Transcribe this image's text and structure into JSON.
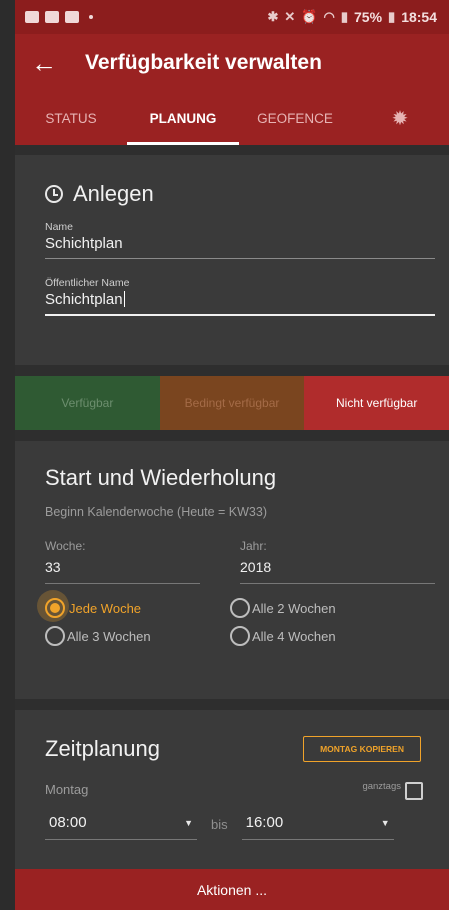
{
  "status_bar": {
    "battery": "75%",
    "time": "18:54"
  },
  "app_bar": {
    "title": "Verfügbarkeit verwalten"
  },
  "tabs": [
    {
      "label": "STATUS"
    },
    {
      "label": "PLANUNG",
      "active": true
    },
    {
      "label": "GEOFENCE"
    }
  ],
  "create": {
    "title": "Anlegen",
    "name_label": "Name",
    "name_value": "Schichtplan",
    "public_label": "Öffentlicher Name",
    "public_value": "Schichtplan"
  },
  "availability": [
    "Verfügbar",
    "Bedingt verfügbar",
    "Nicht verfügbar"
  ],
  "start": {
    "title": "Start und Wiederholung",
    "subtitle": "Beginn Kalenderwoche (Heute = KW33)",
    "week_label": "Woche:",
    "week_value": "33",
    "year_label": "Jahr:",
    "year_value": "2018",
    "repeat": [
      {
        "label": "Jede Woche",
        "checked": true
      },
      {
        "label": "Alle 2 Wochen",
        "checked": false
      },
      {
        "label": "Alle 3 Wochen",
        "checked": false
      },
      {
        "label": "Alle 4 Wochen",
        "checked": false
      }
    ]
  },
  "schedule": {
    "title": "Zeitplanung",
    "copy_label": "MONTAG KOPIEREN",
    "day": "Montag",
    "allday_label": "ganztags",
    "from": "08:00",
    "to_label": "bis",
    "to": "16:00"
  },
  "actions_label": "Aktionen ...",
  "colors": {
    "primary": "#9a2222",
    "accent": "#f0a32a",
    "green": "#2f5a33",
    "orange": "#7a451f",
    "red": "#b02c2c"
  }
}
